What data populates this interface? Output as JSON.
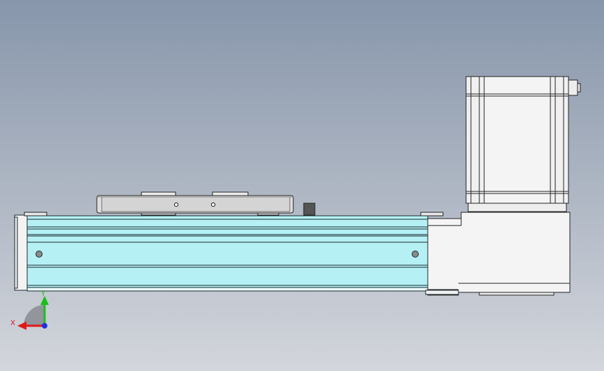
{
  "viewport": {
    "background_top": "#8796ab",
    "background_bottom": "#d3d6dc"
  },
  "model": {
    "name": "",
    "profile_color": "#b4f0f4",
    "profile_stroke": "#1a2a2e",
    "metal_color": "#f2f2f2",
    "carriage_color": "#dcdcdc",
    "sensor_color": "#555555"
  },
  "triad": {
    "x_label": "X",
    "y_label": "Y",
    "x_color": "#e01818",
    "y_color": "#18c018",
    "z_color": "#2030e0"
  }
}
